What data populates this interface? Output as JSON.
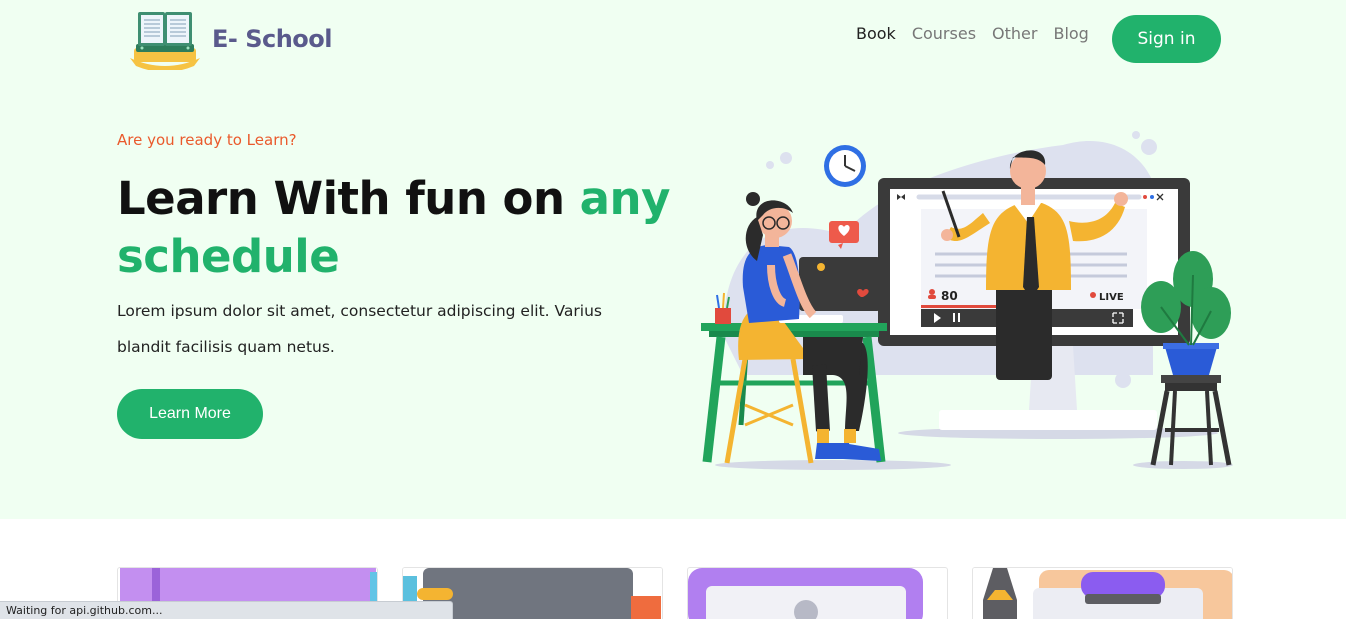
{
  "brand": {
    "name": "E- School"
  },
  "nav": {
    "items": [
      "Book",
      "Courses",
      "Other",
      "Blog"
    ],
    "active": "Book"
  },
  "header": {
    "signin_label": "Sign in"
  },
  "hero": {
    "eyebrow": "Are you ready to Learn?",
    "headline_part1": "Learn With fun on ",
    "headline_accent": "any schedule",
    "description": "Lorem ipsum dolor sit amet, consectetur adipiscing elit. Varius blandit facilisis quam netus.",
    "cta_label": "Learn More"
  },
  "illustration": {
    "viewer_count": "80",
    "live_label": "LIVE"
  },
  "status_bar": {
    "text": "Waiting for api.github.com..."
  },
  "colors": {
    "accent": "#21b26c",
    "eyebrow": "#ea5a2c",
    "hero_bg": "#f0fff2"
  }
}
